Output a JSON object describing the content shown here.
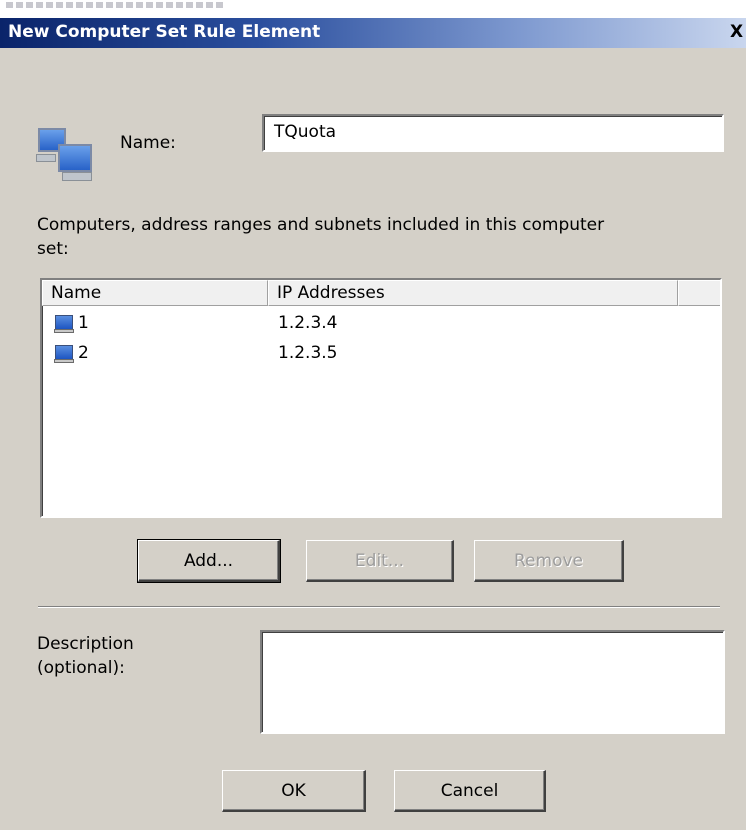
{
  "dialog": {
    "title": "New Computer Set Rule Element",
    "close_glyph": "X"
  },
  "name_field": {
    "label": "Name:",
    "value": "TQuota"
  },
  "computers": {
    "caption_line1": "Computers, address ranges and subnets included in this computer",
    "caption_line2": "set:",
    "columns": [
      "Name",
      "IP Addresses"
    ],
    "rows": [
      {
        "name": "1",
        "ip": "1.2.3.4",
        "icon": "computer-icon"
      },
      {
        "name": "2",
        "ip": "1.2.3.5",
        "icon": "computer-icon"
      }
    ]
  },
  "buttons": {
    "add": "Add...",
    "edit": "Edit...",
    "remove": "Remove",
    "ok": "OK",
    "cancel": "Cancel"
  },
  "description": {
    "label_line1": "Description",
    "label_line2": "(optional):",
    "value": ""
  },
  "icons": {
    "dialog_icon": "computers-set-icon",
    "row_icon": "computer-icon"
  },
  "colors": {
    "titlebar_start": "#0a246a",
    "titlebar_end": "#c9d6ee",
    "dialog_bg": "#d4d0c8"
  }
}
